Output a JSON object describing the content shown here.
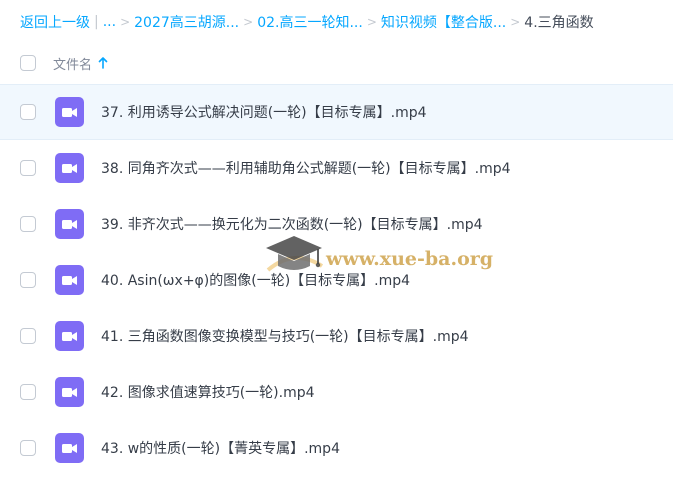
{
  "breadcrumb": {
    "back": "返回上一级",
    "pipe": "|",
    "ellipsis": "...",
    "sep": ">",
    "items": [
      "2027高三胡源...",
      "02.高三一轮知...",
      "知识视频【整合版..."
    ],
    "current": "4.三角函数"
  },
  "header": {
    "name_label": "文件名",
    "sort_icon": "arrow-up-icon"
  },
  "files": [
    {
      "name": "37. 利用诱导公式解决问题(一轮)【目标专属】.mp4",
      "icon": "video-file-icon"
    },
    {
      "name": "38. 同角齐次式——利用辅助角公式解题(一轮)【目标专属】.mp4",
      "icon": "video-file-icon"
    },
    {
      "name": "39. 非齐次式——换元化为二次函数(一轮)【目标专属】.mp4",
      "icon": "video-file-icon"
    },
    {
      "name": "40. Asin(ωx+φ)的图像(一轮)【目标专属】.mp4",
      "icon": "video-file-icon"
    },
    {
      "name": "41. 三角函数图像变换模型与技巧(一轮)【目标专属】.mp4",
      "icon": "video-file-icon"
    },
    {
      "name": "42. 图像求值速算技巧(一轮).mp4",
      "icon": "video-file-icon"
    },
    {
      "name": "43. w的性质(一轮)【菁英专属】.mp4",
      "icon": "video-file-icon"
    }
  ],
  "watermark": {
    "text": "www.xue-ba.org",
    "icon": "graduation-cap-icon"
  },
  "colors": {
    "link": "#06a7ff",
    "video_icon": "#7f6cf5",
    "hover_row": "#f1f8fe"
  }
}
